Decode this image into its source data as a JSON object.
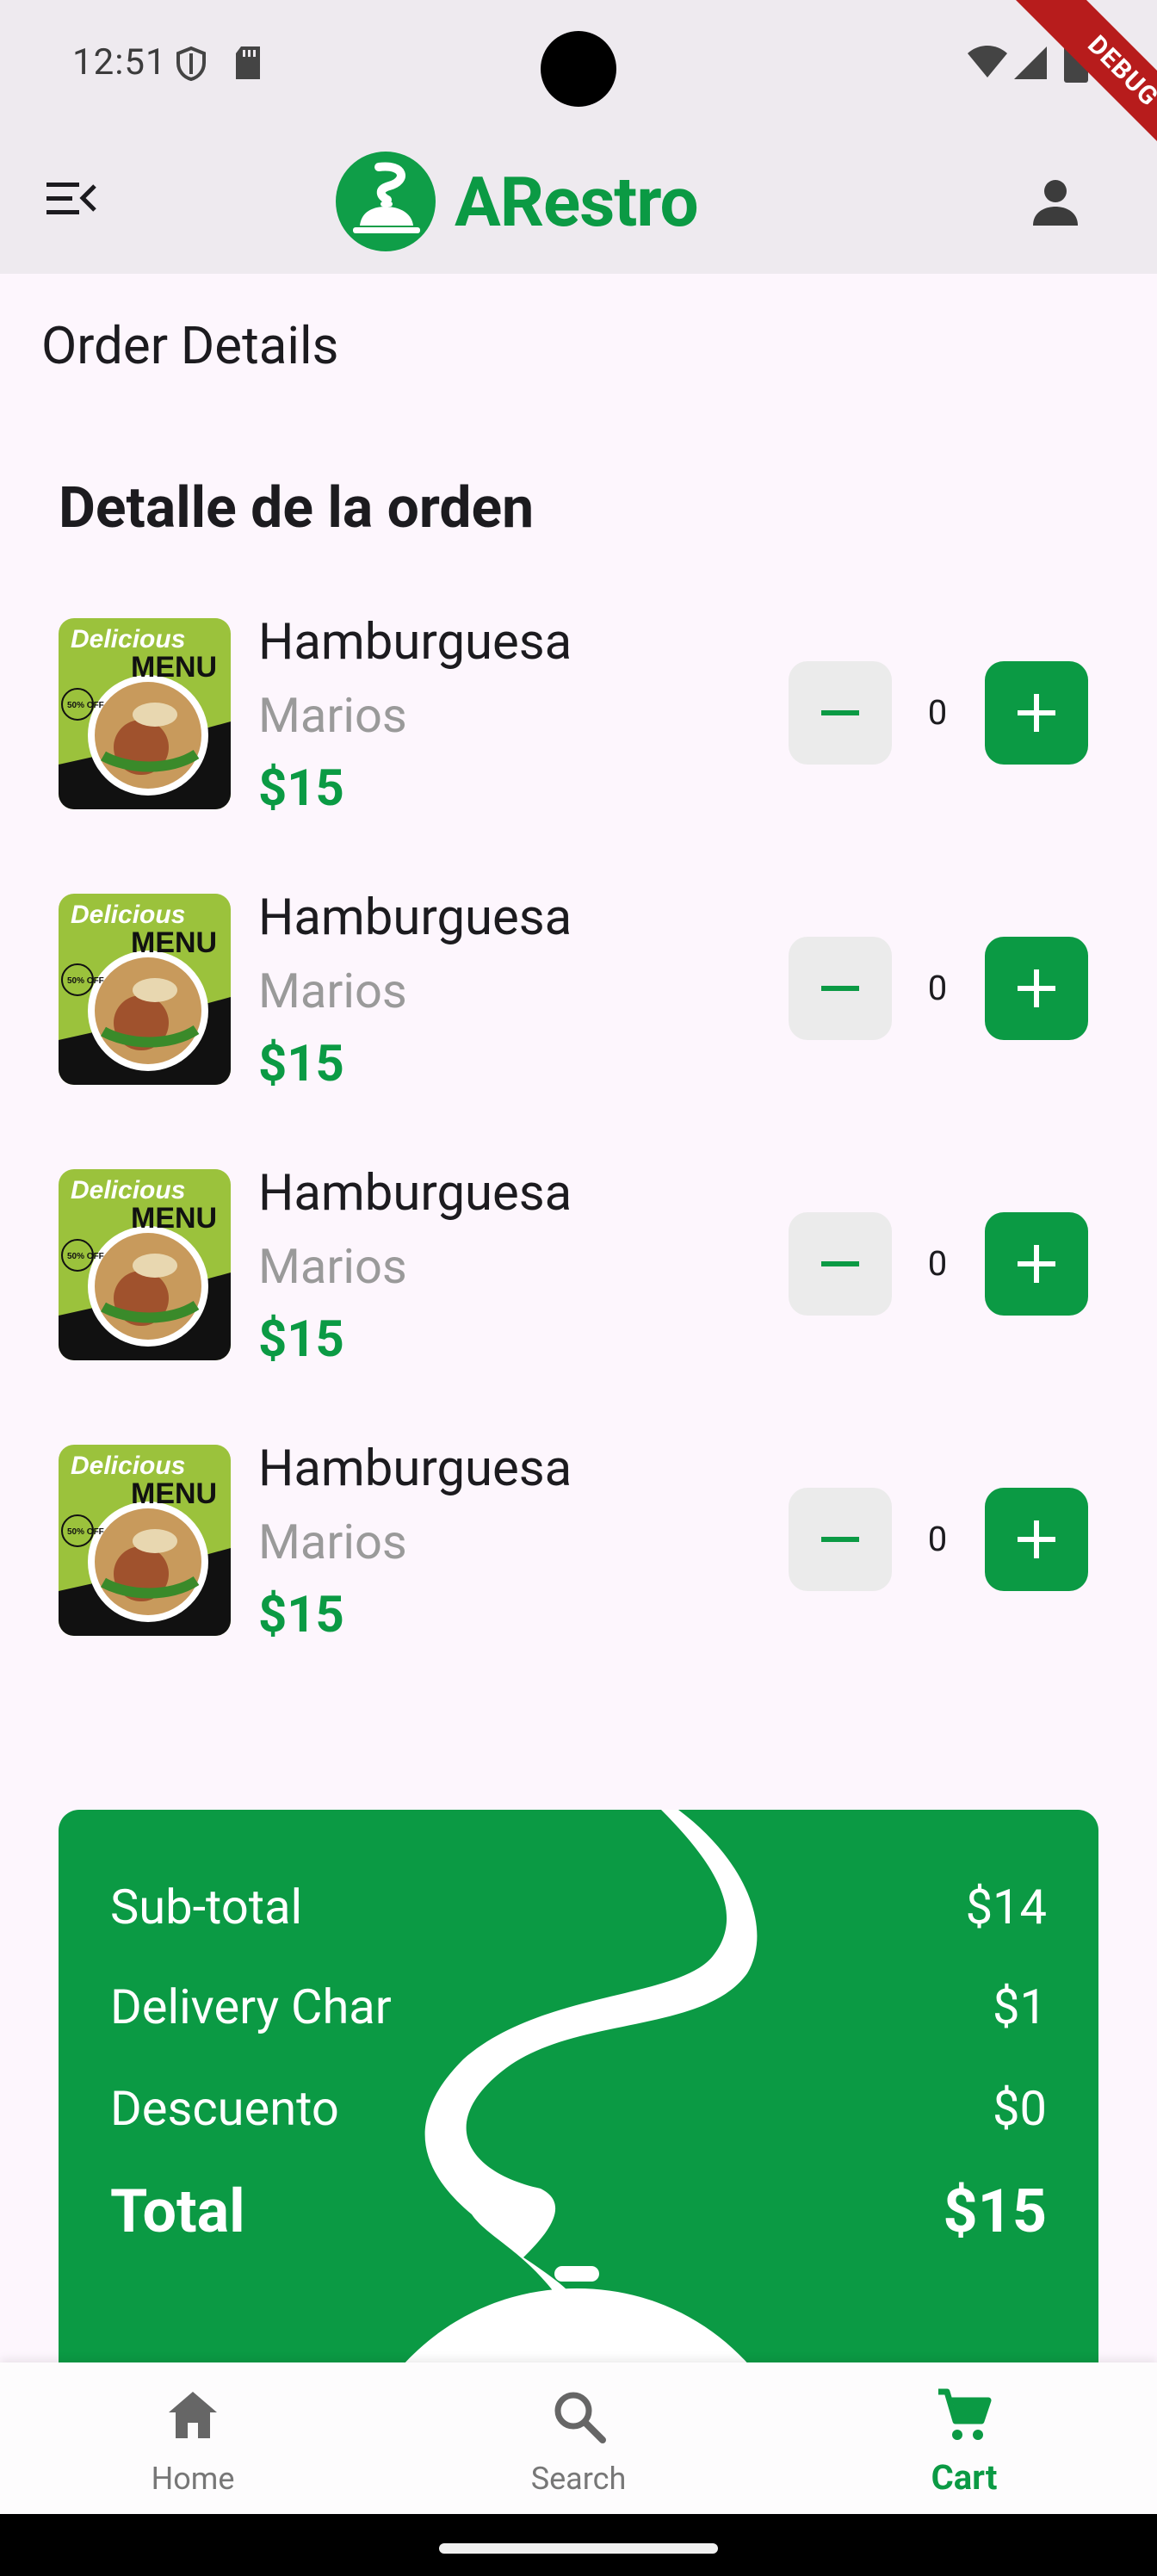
{
  "status_bar": {
    "time": "12:51",
    "debug_label": "DEBUG"
  },
  "app_bar": {
    "logo_text": "ARestro",
    "menu_icon": "menu-open-icon",
    "profile_icon": "person-icon"
  },
  "page": {
    "title": "Order Details",
    "section_title": "Detalle de la orden"
  },
  "order_items": [
    {
      "name": "Hamburguesa",
      "restaurant": "Marios",
      "price": "$15",
      "quantity": "0",
      "image_text_top": "Delicious",
      "image_text_bottom": "MENU",
      "image_badge": "50% OFF"
    },
    {
      "name": "Hamburguesa",
      "restaurant": "Marios",
      "price": "$15",
      "quantity": "0",
      "image_text_top": "Delicious",
      "image_text_bottom": "MENU",
      "image_badge": "50% OFF"
    },
    {
      "name": "Hamburguesa",
      "restaurant": "Marios",
      "price": "$15",
      "quantity": "0",
      "image_text_top": "Delicious",
      "image_text_bottom": "MENU",
      "image_badge": "50% OFF"
    },
    {
      "name": "Hamburguesa",
      "restaurant": "Marios",
      "price": "$15",
      "quantity": "0",
      "image_text_top": "Delicious",
      "image_text_bottom": "MENU",
      "image_badge": "50% OFF"
    }
  ],
  "summary": {
    "subtotal_label": "Sub-total",
    "subtotal_value": "$14",
    "delivery_label": "Delivery Char",
    "delivery_value": "$1",
    "discount_label": "Descuento",
    "discount_value": "$0",
    "total_label": "Total",
    "total_value": "$15"
  },
  "bottom_nav": {
    "items": [
      {
        "label": "Home",
        "icon": "home-icon",
        "active": false
      },
      {
        "label": "Search",
        "icon": "search-icon",
        "active": false
      },
      {
        "label": "Cart",
        "icon": "cart-icon",
        "active": true
      }
    ]
  },
  "colors": {
    "brand_green": "#0b9a44",
    "app_bar_bg": "#eeeaef",
    "page_bg": "#fdf6fd"
  }
}
